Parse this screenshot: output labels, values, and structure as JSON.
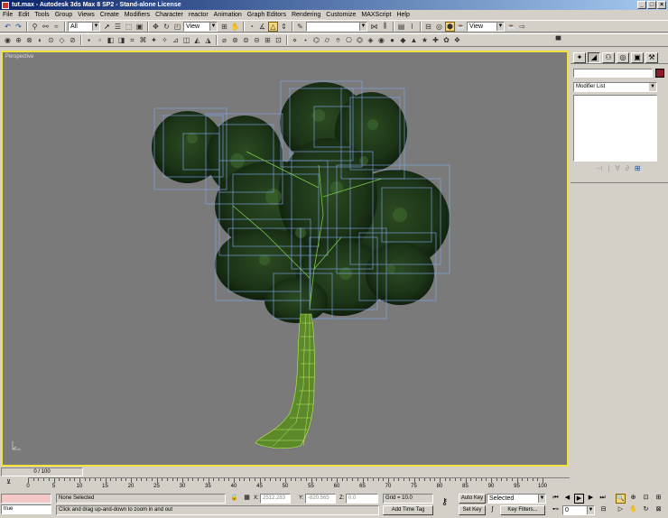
{
  "window": {
    "title": "tut.max - Autodesk 3ds Max 8 SP2 - Stand-alone License",
    "min": "_",
    "max": "□",
    "close": "×"
  },
  "menu": [
    "File",
    "Edit",
    "Tools",
    "Group",
    "Views",
    "Create",
    "Modifiers",
    "Character",
    "reactor",
    "Animation",
    "Graph Editors",
    "Rendering",
    "Customize",
    "MAXScript",
    "Help"
  ],
  "toolbar": {
    "selection_filter": "All",
    "ref_coord": "View",
    "named_selection": "",
    "render_view": "View"
  },
  "viewport": {
    "label": "Perspective",
    "background": "#7a7a7a",
    "border": "#f2e23d"
  },
  "command_panel": {
    "object_name": "",
    "object_color": "#8a1a2a",
    "modifier_list": "Modifier List"
  },
  "time": {
    "slider_label": "0 / 100",
    "ticks": [
      "0",
      "5",
      "10",
      "15",
      "20",
      "25",
      "30",
      "35",
      "40",
      "45",
      "50",
      "55",
      "60",
      "65",
      "70",
      "75",
      "80",
      "85",
      "90",
      "95",
      "100"
    ]
  },
  "status": {
    "listener_text": "true",
    "selection": "None Selected",
    "prompt": "Click and drag up-and-down to zoom in and out",
    "x_label": "X:",
    "x_value": "2512.283",
    "y_label": "Y:",
    "y_value": "-820.565",
    "z_label": "Z:",
    "z_value": "0.0",
    "grid": "Grid = 10.0",
    "add_time_tag": "Add Time Tag",
    "auto_key": "Auto Key",
    "set_key": "Set Key",
    "key_mode": "Selected",
    "key_filters": "Key Filters...",
    "frame": "0"
  }
}
